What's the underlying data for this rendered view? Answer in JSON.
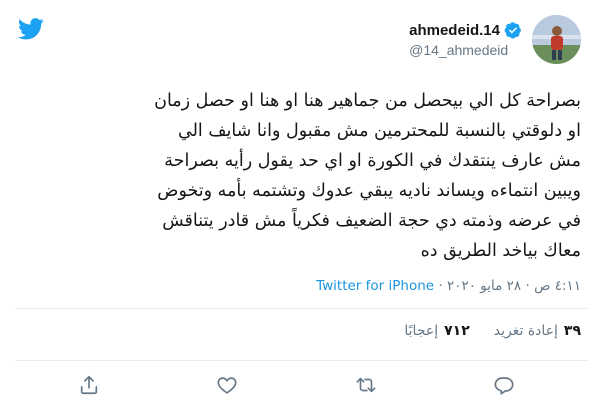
{
  "user": {
    "display_name": "ahmedeid.14",
    "handle": "@14_ahmedeid"
  },
  "tweet": {
    "lines": [
      "بصراحة كل الي بيحصل من جماهير هنا او هنا او حصل زمان",
      "او دلوقتي بالنسبة للمحترمين مش مقبول وانا شايف الي",
      "مش عارف ينتقدك في الكورة او اي حد يقول رأيه بصراحة",
      "ويبين انتماءه ويساند ناديه يبقي عدوك وتشتمه بأمه وتخوض",
      "في عرضه وذمته دي حجة الضعيف فكرياً مش قادر يتناقش",
      "معاك بياخد الطريق ده"
    ]
  },
  "meta": {
    "time": "٤:١١ ص",
    "separator": "·",
    "date": "٢٨ مايو ٢٠٢٠",
    "source": "Twitter for iPhone"
  },
  "stats": {
    "retweets_count": "٣٩",
    "retweets_label": "إعادة تغريد",
    "likes_count": "٧١٢",
    "likes_label": "إعجابًا"
  },
  "colors": {
    "accent": "#1b95e0",
    "verified": "#1da1f2",
    "muted": "#657786",
    "border": "#e6ecf0"
  },
  "icons": {
    "brand": "twitter-bird-icon",
    "verified": "verified-badge-icon",
    "reply": "reply-icon",
    "retweet": "retweet-icon",
    "like": "heart-icon",
    "share": "share-icon"
  }
}
